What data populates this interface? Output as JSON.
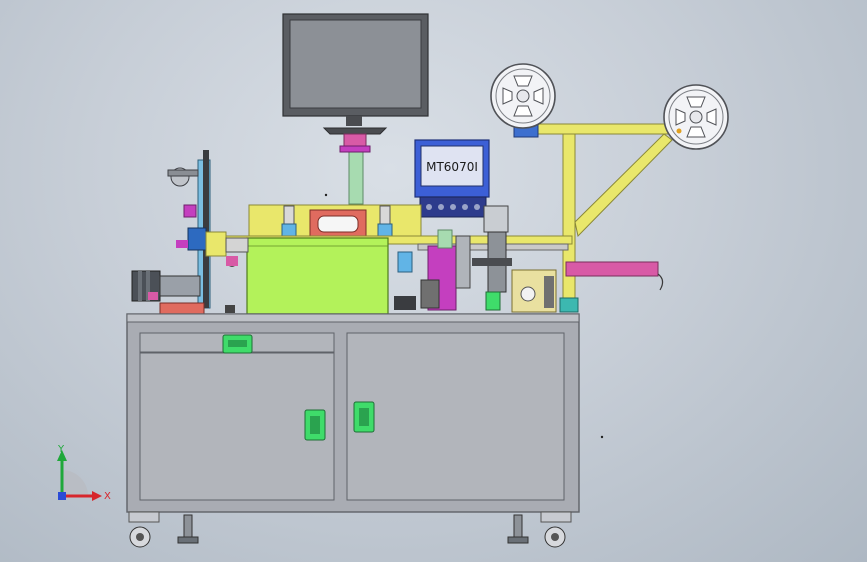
{
  "scene": {
    "controller_label": "MT6070I",
    "axis_labels": {
      "y": "Y",
      "x": "X"
    },
    "colors": {
      "cabinet": "#a9acb3",
      "cabinet_line": "#5f6268",
      "green_housing": "#b3f25a",
      "yellow_frame": "#e9e76b",
      "pink": "#d85aa6",
      "magenta": "#c43fbf",
      "controller_blue": "#3c5fd6",
      "monitor_frame": "#5a5d62",
      "monitor_screen": "#8c9096",
      "handle_green": "#3fdc6a",
      "mint": "#a7dbb0"
    }
  }
}
